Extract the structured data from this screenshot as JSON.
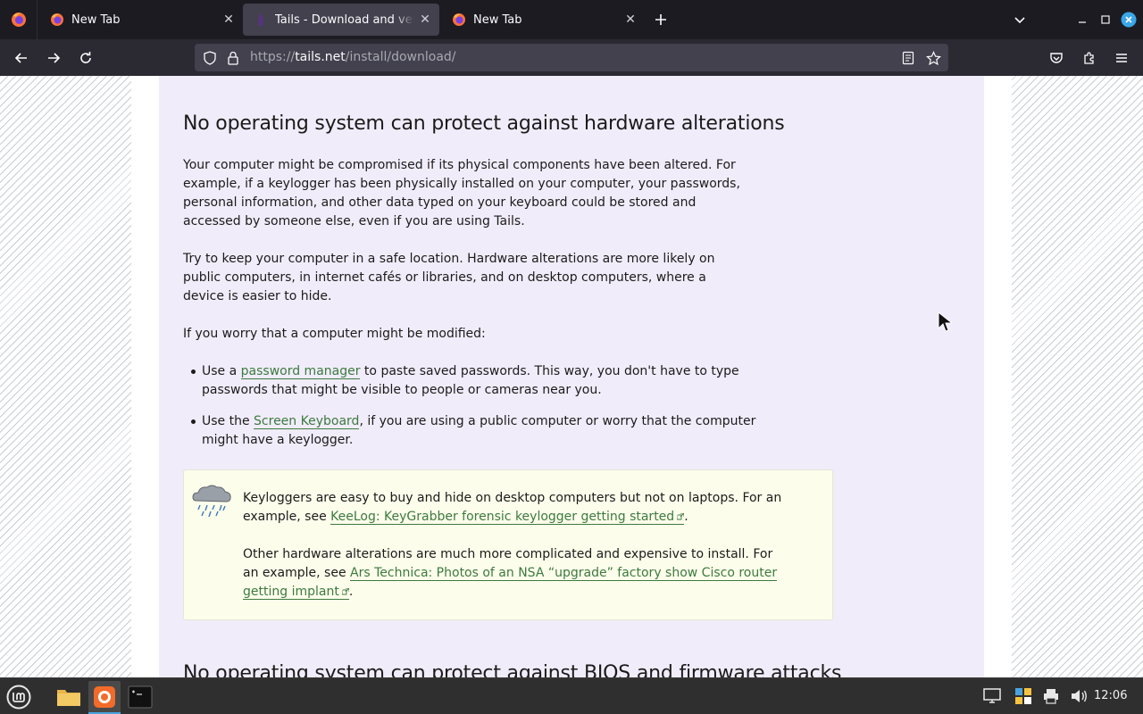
{
  "browser": {
    "tabs": [
      {
        "title": "New Tab",
        "active": false
      },
      {
        "title": "Tails - Download and verify",
        "active": true
      },
      {
        "title": "New Tab",
        "active": false
      }
    ],
    "url": {
      "scheme": "https://",
      "host": "tails.net",
      "path": "/install/download/"
    }
  },
  "page": {
    "heading": "No operating system can protect against hardware alterations",
    "paragraphs": [
      "Your computer might be compromised if its physical components have been altered. For example, if a keylogger has been physically installed on your computer, your passwords, personal information, and other data typed on your keyboard could be stored and accessed by someone else, even if you are using Tails.",
      "Try to keep your computer in a safe location. Hardware alterations are more likely on public computers, in internet cafés or libraries, and on desktop computers, where a device is easier to hide.",
      "If you worry that a computer might be modified:"
    ],
    "bullets": [
      {
        "before": "Use a ",
        "link": "password manager",
        "after": " to paste saved passwords. This way, you don't have to type passwords that might be visible to people or cameras near you."
      },
      {
        "before": "Use the ",
        "link": "Screen Keyboard",
        "after": ", if you are using a public computer or worry that the computer might have a keylogger."
      }
    ],
    "note": {
      "icon": "rain-cloud-icon",
      "p1_before": "Keyloggers are easy to buy and hide on desktop computers but not on laptops. For an example, see ",
      "p1_link": "KeeLog: KeyGrabber forensic keylogger getting started",
      "p1_after": ".",
      "p2_before": "Other hardware alterations are much more complicated and expensive to install. For an example, see ",
      "p2_link": "Ars Technica: Photos of an NSA “upgrade” factory show Cisco router getting implant",
      "p2_after": "."
    },
    "next_heading": "No operating system can protect against BIOS and firmware attacks"
  },
  "taskbar": {
    "apps": [
      "menu-icon",
      "files-icon",
      "firefox-icon",
      "terminal-icon"
    ],
    "clock": "12:06"
  },
  "colors": {
    "link": "#3c7a3f",
    "panel": "#f1ecfa",
    "note_bg": "#fdfdeb"
  }
}
